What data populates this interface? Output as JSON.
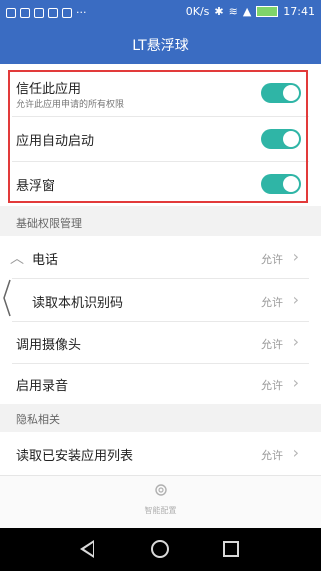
{
  "status_bar": {
    "network_speed": "0K/s",
    "time": "17:41"
  },
  "title": "LT悬浮球",
  "trust": {
    "label": "信任此应用",
    "sub": "允许此应用申请的所有权限"
  },
  "toggles": [
    {
      "label": "应用自动启动"
    },
    {
      "label": "悬浮窗"
    }
  ],
  "sections": {
    "basic": "基础权限管理",
    "privacy": "隐私相关"
  },
  "permissions": [
    {
      "label": "电话",
      "value": "允许"
    },
    {
      "label": "读取本机识别码",
      "value": "允许"
    },
    {
      "label": "调用摄像头",
      "value": "允许"
    },
    {
      "label": "启用录音",
      "value": "允许"
    }
  ],
  "privacy_items": [
    {
      "label": "读取已安装应用列表",
      "value": "允许"
    }
  ],
  "bottom": {
    "smart_config": "智能配置"
  },
  "colors": {
    "accent": "#3a6cc2",
    "toggle_on": "#2fb5a6",
    "highlight_box": "#e23a3a"
  }
}
